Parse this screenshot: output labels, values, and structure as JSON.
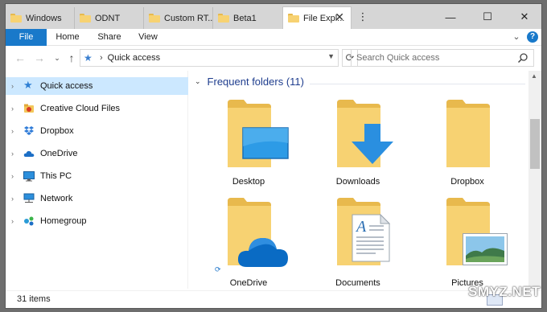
{
  "tabs": [
    {
      "title": "Windows",
      "active": false
    },
    {
      "title": "ODNT",
      "active": false
    },
    {
      "title": "Custom RT...",
      "active": false
    },
    {
      "title": "Beta1",
      "active": false
    },
    {
      "title": "File Expl...",
      "active": true
    }
  ],
  "window_controls": {
    "menu": "⋮",
    "minimize": "—",
    "maximize": "☐",
    "close": "✕"
  },
  "ribbon": {
    "file": "File",
    "home": "Home",
    "share": "Share",
    "view": "View",
    "expand": "⌄",
    "help": "?"
  },
  "address": {
    "location": "Quick access",
    "separator": "›"
  },
  "search": {
    "placeholder": "Search Quick access"
  },
  "nav_pane": [
    {
      "label": "Quick access",
      "icon": "star-icon",
      "selected": true
    },
    {
      "label": "Creative Cloud Files",
      "icon": "creative-cloud-icon",
      "selected": false
    },
    {
      "label": "Dropbox",
      "icon": "dropbox-icon",
      "selected": false
    },
    {
      "label": "OneDrive",
      "icon": "onedrive-icon",
      "selected": false
    },
    {
      "label": "This PC",
      "icon": "computer-icon",
      "selected": false
    },
    {
      "label": "Network",
      "icon": "network-icon",
      "selected": false
    },
    {
      "label": "Homegroup",
      "icon": "homegroup-icon",
      "selected": false
    }
  ],
  "content": {
    "group_title": "Frequent folders (11)",
    "folders": [
      {
        "name": "Desktop",
        "overlay": "desktop-icon"
      },
      {
        "name": "Downloads",
        "overlay": "download-arrow-icon"
      },
      {
        "name": "Dropbox",
        "overlay": "none"
      },
      {
        "name": "OneDrive",
        "overlay": "onedrive-cloud-icon"
      },
      {
        "name": "Documents",
        "overlay": "document-icon"
      },
      {
        "name": "Pictures",
        "overlay": "picture-icon"
      }
    ]
  },
  "status": {
    "items": "31 items"
  },
  "watermark": "SMYZ.NET",
  "colors": {
    "accent": "#1979ca",
    "selection": "#cce8ff",
    "folder": "#f7d272",
    "folder_dark": "#e7b94c",
    "heading": "#1e3d8e"
  }
}
